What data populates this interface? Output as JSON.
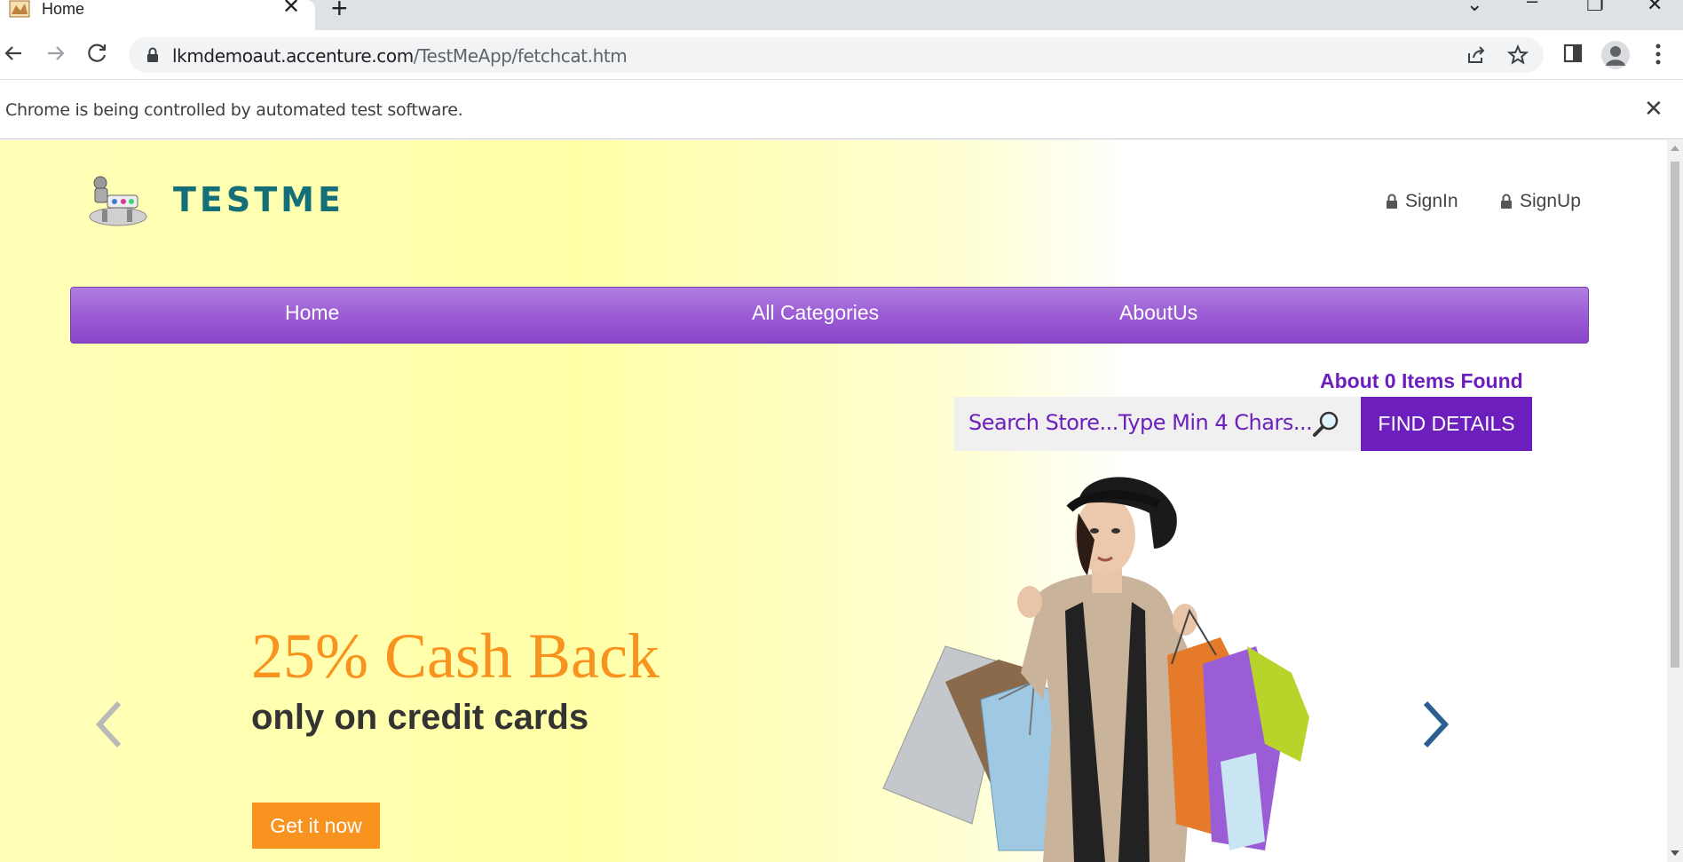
{
  "browser": {
    "tab_title": "Home",
    "url_host": "lkmdemoaut.accenture.com",
    "url_path": "/TestMeApp/fetchcat.htm",
    "infobar_text": "Chrome is being controlled by automated test software."
  },
  "header": {
    "logo_text": "TESTME",
    "signin_label": "SignIn",
    "signup_label": "SignUp"
  },
  "nav": {
    "items": [
      {
        "label": "Home"
      },
      {
        "label": "All Categories"
      },
      {
        "label": "AboutUs"
      }
    ]
  },
  "search": {
    "items_found": "About 0 Items Found",
    "placeholder": "Search Store...Type Min 4 Chars...",
    "button_label": "FIND DETAILS"
  },
  "promo": {
    "title": "25% Cash Back",
    "subtitle": "only on credit cards",
    "button_label": "Get it now"
  },
  "colors": {
    "accent": "#6c1fbd",
    "nav_purple": "#9d5fd6",
    "promo_orange": "#f7931e",
    "logo_teal": "#156f79"
  },
  "icons": [
    "tab-favicon",
    "close-icon",
    "plus-icon",
    "back-arrow-icon",
    "forward-arrow-icon",
    "reload-icon",
    "lock-icon",
    "share-icon",
    "star-icon",
    "sidepanel-icon",
    "profile-icon",
    "menu-dots-icon",
    "search-icon",
    "chevron-left-icon",
    "chevron-right-icon"
  ]
}
